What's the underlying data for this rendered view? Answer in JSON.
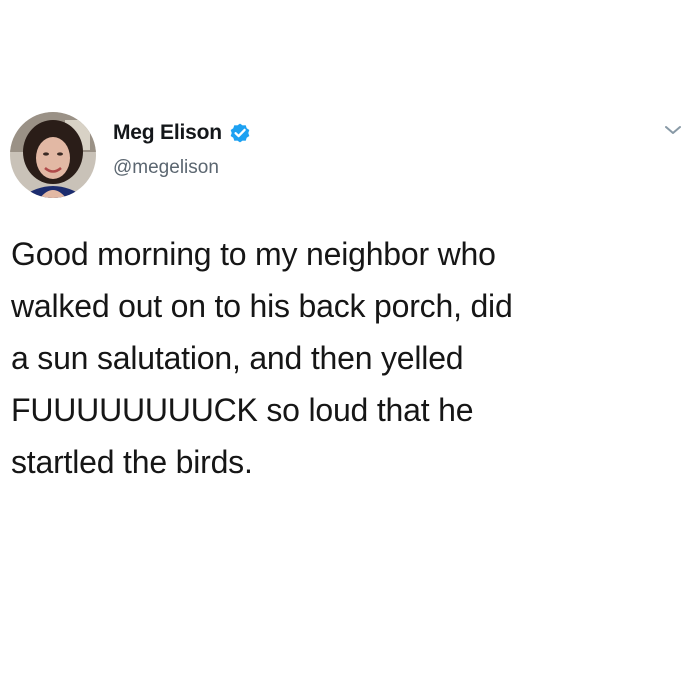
{
  "tweet": {
    "author": {
      "display_name": "Meg Elison",
      "handle": "@megelison",
      "verified": true,
      "avatar_icon": "profile-photo"
    },
    "menu_icon": "chevron-down-icon",
    "text": "Good morning to my neighbor who\nwalked out on to his back porch, did\na sun salutation, and then yelled\nFUUUUUUUUCK so loud that he\nstartled the birds."
  },
  "colors": {
    "background": "#ffffff",
    "text": "#161616",
    "handle": "#5b6670",
    "verified_badge": "#1da1f2",
    "chevron": "#8899a6"
  }
}
